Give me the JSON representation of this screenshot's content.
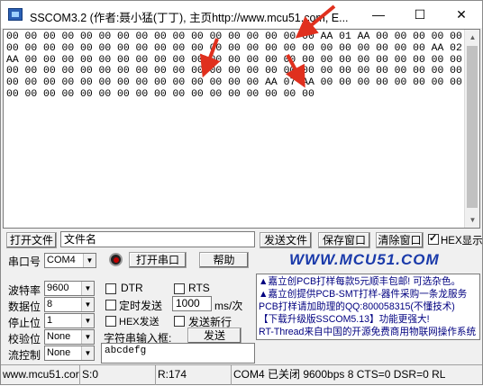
{
  "window": {
    "title": "SSCOM3.2 (作者:聂小猛(丁丁), 主页http://www.mcu51.com,  E...",
    "buttons": {
      "minimize": "—",
      "maximize": "☐",
      "close": "✕"
    }
  },
  "receive": {
    "text": "00 00 00 00 00 00 00 00 00 00 00 00 00 00 00 00 00 AA 01 AA 00 00 00 00 00 00 00 00 00 00 00 00 00 00 00 00 00 00 00 00 00 00 00 00 00 00 00 00 AA 02 AA 00 00 00 00 00 00 00 00 00 00 00 00 00 00 00 00 00 00 00 00 00 00 00 00 00 00 00 00 00 00 00 00 00 00 00 00 00 00 00 00 00 00 00 00 00 00 00 00 00 00 00 00 00 00 00 00 00 00 00 00 00 00 00 AA 07 AA 00 00 00 00 00 00 00 00 00 00 00 00 00 00 00 00 00 00 00 00 00 00 00 00 00"
  },
  "toolbar1": {
    "open_file": "打开文件",
    "filename": "文件名",
    "send_file": "发送文件",
    "save_window": "保存窗口",
    "clear_window": "清除窗口",
    "hex_display": "HEX显示"
  },
  "port": {
    "label": "串口号",
    "value": "COM4",
    "open_port": "打开串口",
    "help": "帮助"
  },
  "brand": "WWW.MCU51.COM",
  "settings": {
    "baud_label": "波特率",
    "baud": "9600",
    "databits_label": "数据位",
    "databits": "8",
    "stopbits_label": "停止位",
    "stopbits": "1",
    "parity_label": "校验位",
    "parity": "None",
    "flow_label": "流控制",
    "flow": "None"
  },
  "options": {
    "dtr": "DTR",
    "rts": "RTS",
    "timed_send": "定时发送",
    "interval": "1000",
    "interval_unit": "ms/次",
    "hex_send": "HEX发送",
    "send_newline": "发送新行",
    "input_label": "字符串输入框:",
    "send": "发送",
    "input_value": "abcdefg"
  },
  "news": [
    "▲嘉立创PCB打样每款5元顺丰包邮! 可选杂色。",
    "▲嘉立创提供PCB-SMT打样-器件采购一条龙服务",
    "PCB打样请加助理的QQ:800058315(不懂技术)",
    "【下载升级版SSCOM5.13】功能更强大!",
    "RT-Thread来自中国的开源免费商用物联网操作系统"
  ],
  "status": {
    "site": "www.mcu51.cor",
    "sent": "S:0",
    "received": "R:174",
    "port_state": "COM4 已关闭  9600bps  8  CTS=0 DSR=0 RL"
  },
  "colors": {
    "arrow": "#e0301e",
    "brand": "#1a3aaa",
    "led": "#c00000"
  }
}
